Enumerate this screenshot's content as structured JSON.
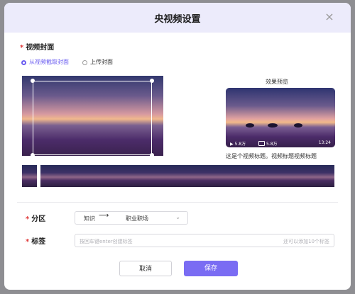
{
  "dialog": {
    "title": "央视频设置",
    "close_icon": "×"
  },
  "cover": {
    "label": "视频封面",
    "required_mark": "*",
    "options": [
      {
        "label": "从视频截取封面",
        "checked": true
      },
      {
        "label": "上传封面",
        "checked": false
      }
    ]
  },
  "preview": {
    "label": "效果预览",
    "views": "5.8万",
    "comments": "5.8万",
    "duration": "13:24",
    "title": "这是个视频标题。视频标题视频标题"
  },
  "category": {
    "label": "分区",
    "required_mark": "*",
    "value_parent": "知识",
    "arrow": "⟶",
    "value_child": "职业职场",
    "chevron": "⌄"
  },
  "tags": {
    "label": "标签",
    "required_mark": "*",
    "placeholder": "按回车键enter创建标签",
    "hint": "还可以添加10个标签"
  },
  "buttons": {
    "cancel": "取消",
    "save": "保存"
  },
  "colors": {
    "accent": "#7a6cf3",
    "required": "#e03b3b",
    "header_bg": "#ecebfb"
  }
}
